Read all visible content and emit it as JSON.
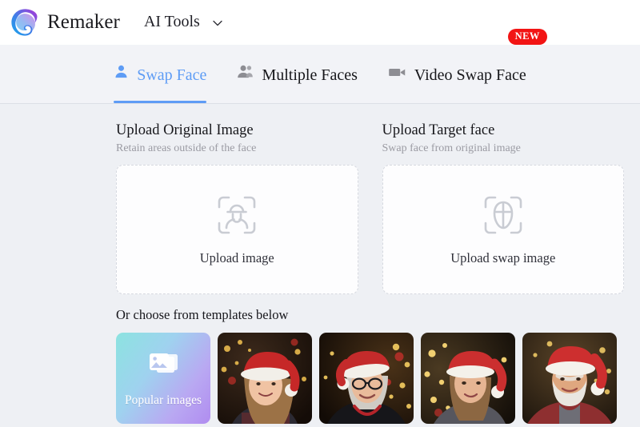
{
  "header": {
    "logo_icon": "remaker-swirl-logo",
    "brand": "Remaker",
    "menu": {
      "label": "AI Tools",
      "chevron_icon": "chevron-down-icon"
    }
  },
  "tabs": [
    {
      "label": "Swap Face",
      "icon": "single-person-icon",
      "active": true,
      "badge": ""
    },
    {
      "label": "Multiple Faces",
      "icon": "multiple-people-icon",
      "active": false,
      "badge": ""
    },
    {
      "label": "Video Swap Face",
      "icon": "video-camera-icon",
      "active": false,
      "badge": "NEW"
    }
  ],
  "upload": {
    "original": {
      "title": "Upload Original Image",
      "subtitle": "Retain areas outside of the face",
      "icon": "face-scan-body-icon",
      "cta": "Upload image"
    },
    "target": {
      "title": "Upload Target face",
      "subtitle": "Swap face from original image",
      "icon": "face-scan-oval-icon",
      "cta": "Upload swap image"
    }
  },
  "templates": {
    "heading": "Or choose from templates below",
    "items": [
      {
        "type": "popular",
        "label": "Popular images",
        "icon": "stacked-images-icon"
      },
      {
        "type": "photo",
        "label": "Young girl with Santa hat by Christmas tree"
      },
      {
        "type": "photo",
        "label": "Older woman with glasses and Santa hat"
      },
      {
        "type": "photo",
        "label": "Young woman with Santa hat and holiday lights"
      },
      {
        "type": "photo",
        "label": "Bearded man with Santa hat in red sweater"
      }
    ]
  },
  "colors": {
    "accent_blue": "#5e9cf5",
    "badge_red": "#f21414",
    "page_bg": "#eef0f4",
    "header_bg": "#ffffff",
    "muted_text": "#9b9ba3"
  }
}
